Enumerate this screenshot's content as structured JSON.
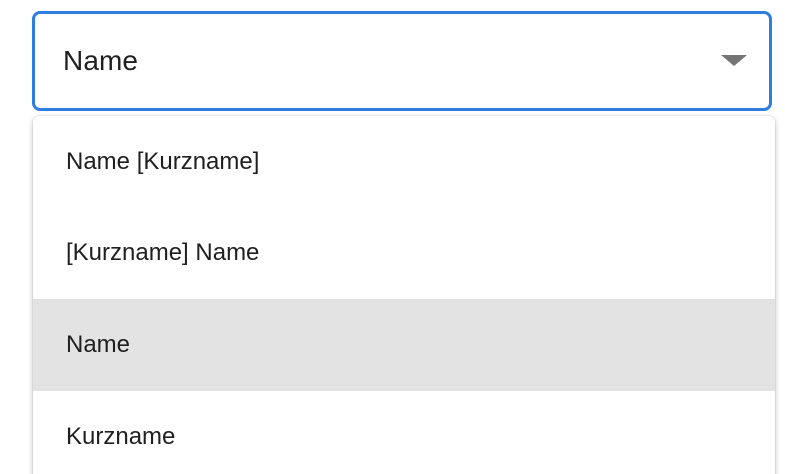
{
  "select": {
    "value": "Name",
    "arrow_icon": "triangle-down-icon",
    "accent_color": "#2f7de1"
  },
  "menu": {
    "items": [
      {
        "label": "Name [Kurzname]",
        "selected": false
      },
      {
        "label": "[Kurzname] Name",
        "selected": false
      },
      {
        "label": "Name",
        "selected": true
      },
      {
        "label": "Kurzname",
        "selected": false
      }
    ],
    "selected_bg": "#e3e3e3"
  }
}
